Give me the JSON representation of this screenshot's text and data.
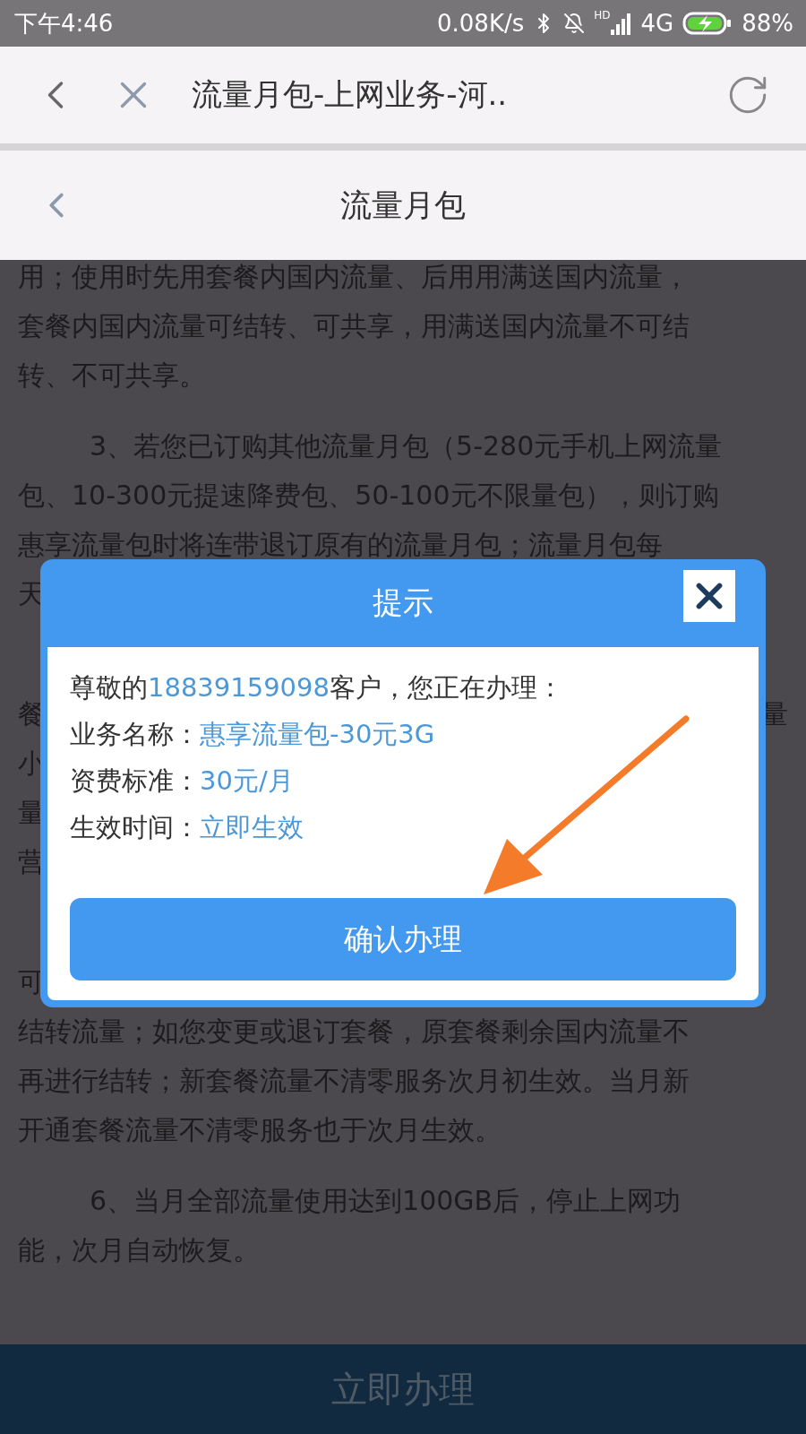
{
  "status_bar": {
    "time": "下午4:46",
    "speed": "0.08K/s",
    "hd": "HD",
    "network": "4G",
    "battery": "88%"
  },
  "browser_bar": {
    "title": "流量月包-上网业务-河.."
  },
  "page_header": {
    "title": "流量月包"
  },
  "paragraphs": [
    {
      "kind": "plain",
      "lines": [
        {
          "text": "用；使用时先用套餐内国内流量、后用用满送国内流量，"
        },
        {
          "text": "套餐内国内流量可结转、可共享，用满送国内流量不可结"
        },
        {
          "text": "转、不可共享。"
        }
      ]
    },
    {
      "kind": "indented",
      "lines": [
        {
          "text": "3、若您已订购其他流量月包（5-280元手机上网流量"
        },
        {
          "text": "包、10-300元提速降费包、50-100元不限量包），则订购"
        },
        {
          "text": "惠享流量包时将连带退订原有的流量月包；流量月包每"
        },
        {
          "left": "天"
        }
      ]
    },
    {
      "kind": "covered-start",
      "lines": [
        {
          "left": "餐",
          "right": "量"
        },
        {
          "left": "小"
        },
        {
          "left": "量"
        },
        {
          "left": "营"
        }
      ]
    },
    {
      "kind": "covered-start",
      "lines": [
        {
          "left": "可"
        },
        {
          "text": "结转流量；如您变更或退订套餐，原套餐剩余国内流量不"
        },
        {
          "text": "再进行结转；新套餐流量不清零服务次月初生效。当月新"
        },
        {
          "text": "开通套餐流量不清零服务也于次月生效。"
        }
      ]
    },
    {
      "kind": "indented",
      "lines": [
        {
          "text": "6、当月全部流量使用达到100GB后，停止上网功"
        },
        {
          "text": "能，次月自动恢复。"
        }
      ]
    }
  ],
  "dialog": {
    "title": "提示",
    "greeting": {
      "before": "尊敬的",
      "number": "18839159098",
      "after": "客户，您正在办理："
    },
    "fields": [
      {
        "label": "业务名称：",
        "value": "惠享流量包-30元3G"
      },
      {
        "label": "资费标准：",
        "value": "30元/月"
      },
      {
        "label": "生效时间：",
        "value": "立即生效"
      }
    ],
    "confirm": "确认办理"
  },
  "bottom_bar": {
    "button": "立即办理"
  }
}
